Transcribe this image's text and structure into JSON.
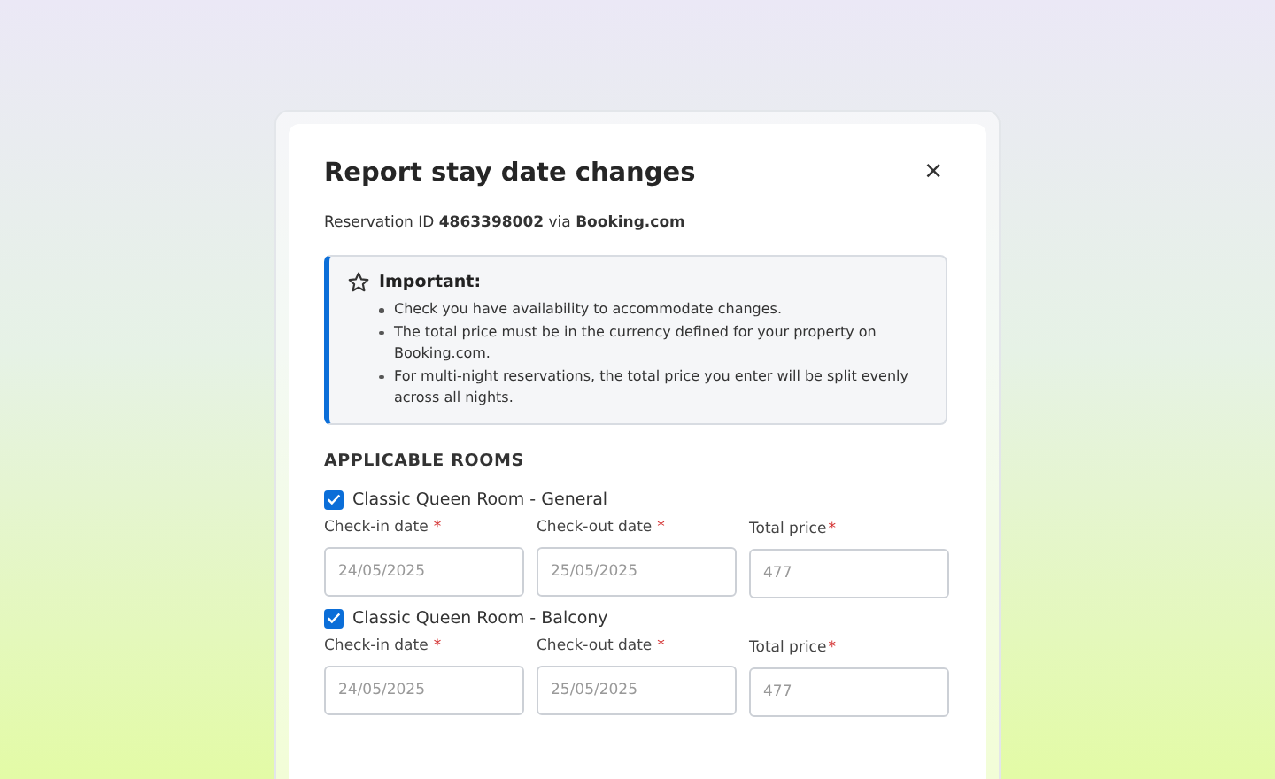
{
  "dialog": {
    "title": "Report stay date changes",
    "close": "×",
    "reservation": "Reservation ID **4863398002** via **Booking.com**",
    "notice": {
      "title": "Important:",
      "items": [
        "Check you have availability to accommodate changes.",
        "The total price must be in the currency defined for your property on Booking.com.",
        "For multi-night reservations, the total price you enter will be split evenly across all nights."
      ]
    },
    "section_title": "APPLICABLE ROOMS",
    "rooms": [
      {
        "name": "Classic Queen Room - General",
        "checked": true,
        "fields": [
          {
            "label": "Check-in date",
            "required_mark": "*",
            "value": "24/05/2025"
          },
          {
            "label": "Check-out date",
            "required_mark": "*",
            "value": "25/05/2025"
          },
          {
            "label": "Total price",
            "required_mark": "*",
            "value": "477"
          }
        ]
      },
      {
        "name": "Classic Queen Room - Balcony",
        "checked": true,
        "fields": [
          {
            "label": "Check-in date",
            "required_mark": "*",
            "value": "24/05/2025"
          },
          {
            "label": "Check-out date",
            "required_mark": "*",
            "value": "25/05/2025"
          },
          {
            "label": "Total price",
            "required_mark": "*",
            "value": "477"
          }
        ]
      }
    ]
  }
}
